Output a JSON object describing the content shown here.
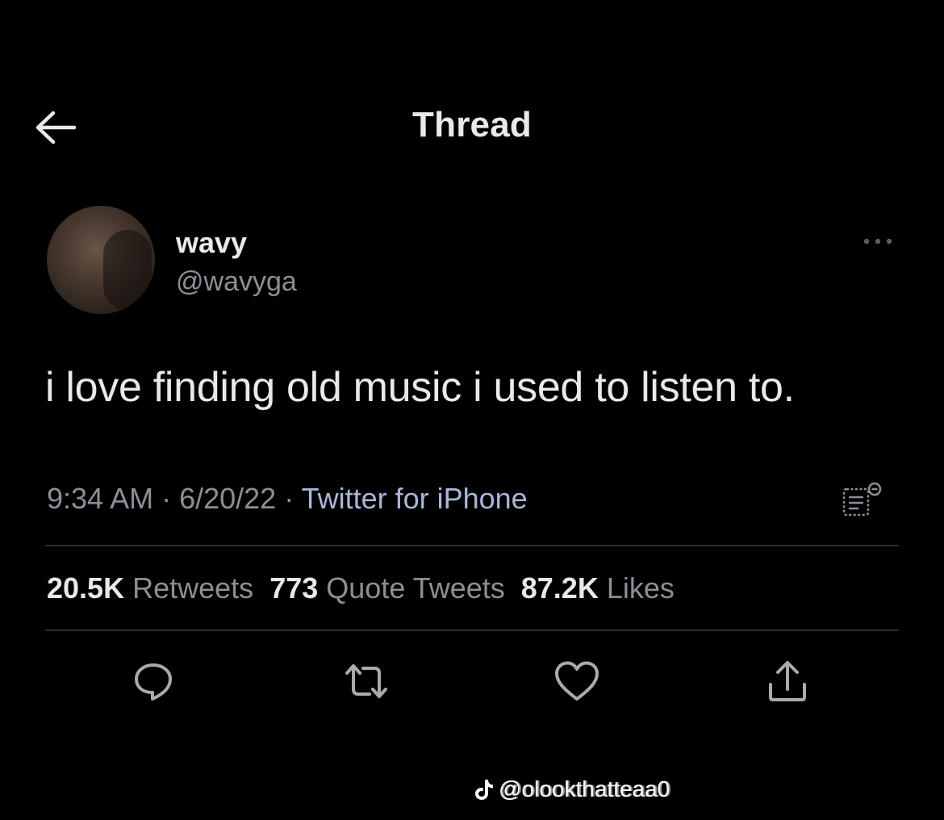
{
  "header": {
    "title": "Thread",
    "back_icon": "arrow-left-icon"
  },
  "tweet": {
    "author": {
      "display_name": "wavy",
      "handle": "@wavyga"
    },
    "text": "i love finding old music i used to listen to.",
    "time": "9:34 AM",
    "separator": " · ",
    "date": "6/20/22",
    "source": "Twitter for iPhone",
    "stats": {
      "retweets_count": "20.5K",
      "retweets_label": "Retweets",
      "quotes_count": "773",
      "quotes_label": "Quote Tweets",
      "likes_count": "87.2K",
      "likes_label": "Likes"
    },
    "actions": [
      "reply-icon",
      "retweet-icon",
      "like-icon",
      "share-icon"
    ]
  },
  "watermark": {
    "text": "@olookthatteaa0",
    "icon": "tiktok-icon"
  },
  "colors": {
    "background": "#000000",
    "text_primary": "#e7e9ea",
    "text_secondary": "#8b9096",
    "source_link": "#a9b6d8",
    "divider": "#2a2d31"
  }
}
